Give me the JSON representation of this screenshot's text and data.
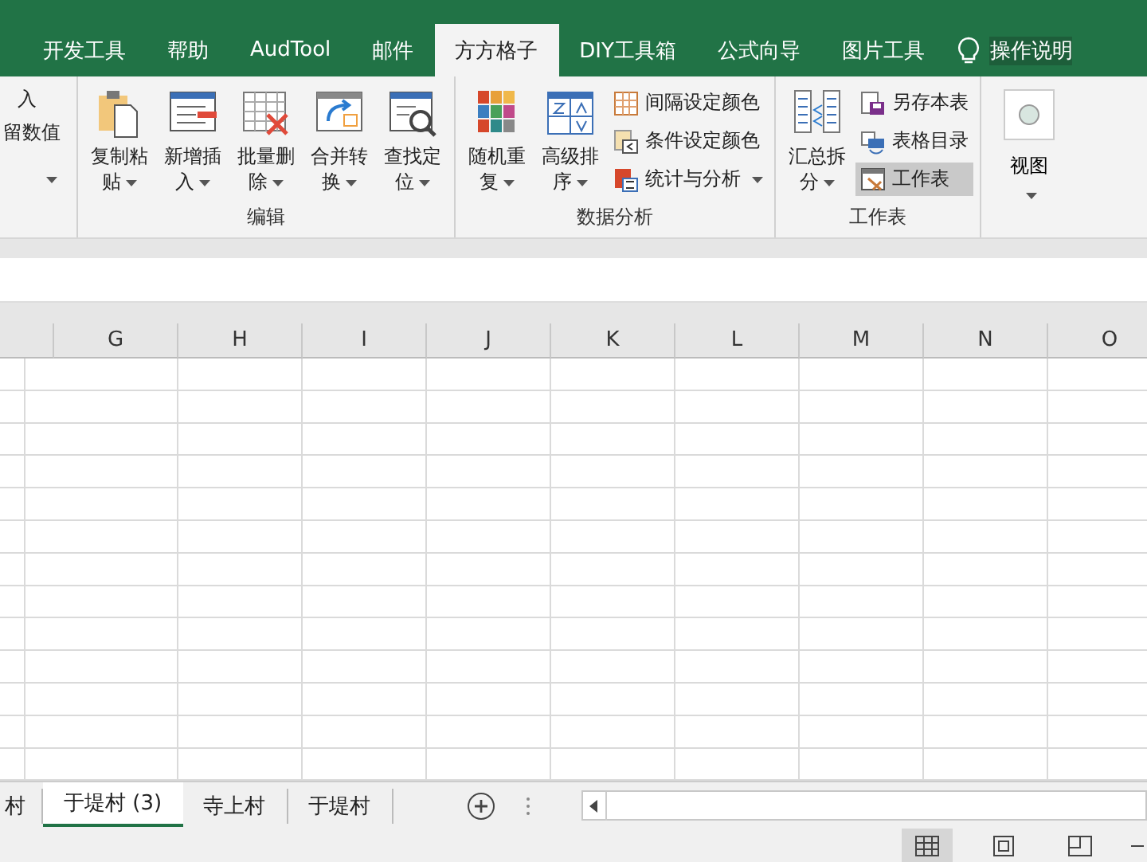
{
  "menu_tabs": [
    {
      "label": "开发工具",
      "selected": false
    },
    {
      "label": "帮助",
      "selected": false
    },
    {
      "label": "AudTool",
      "selected": false
    },
    {
      "label": "邮件",
      "selected": false
    },
    {
      "label": "方方格子",
      "selected": true
    },
    {
      "label": "DIY工具箱",
      "selected": false
    },
    {
      "label": "公式向导",
      "selected": false
    },
    {
      "label": "图片工具",
      "selected": false
    }
  ],
  "tell_me": "操作说明",
  "ribbon_groups": [
    {
      "dropdown": true,
      "items": [
        {
          "kind": "text",
          "label": "入"
        },
        {
          "kind": "text",
          "label": "留数值"
        }
      ]
    },
    {
      "label": "编辑",
      "items": [
        {
          "kind": "large",
          "label": "复制粘贴",
          "dropdown": true
        },
        {
          "kind": "large",
          "label": "新增插入",
          "dropdown": true
        },
        {
          "kind": "large",
          "label": "批量删除",
          "dropdown": true
        },
        {
          "kind": "large",
          "label": "合并转换",
          "dropdown": true
        },
        {
          "kind": "large",
          "label": "查找定位",
          "dropdown": true
        }
      ]
    },
    {
      "label": "数据分析",
      "items": [
        {
          "kind": "large",
          "label": "随机重复",
          "dropdown": true
        },
        {
          "kind": "large",
          "label": "高级排序",
          "dropdown": true
        },
        {
          "kind": "small",
          "label": "间隔设定颜色",
          "dropdown": false,
          "selected": false
        },
        {
          "kind": "small",
          "label": "条件设定颜色",
          "dropdown": false,
          "selected": false
        },
        {
          "kind": "small",
          "label": "统计与分析",
          "dropdown": true,
          "selected": false
        }
      ]
    },
    {
      "label": "工作表",
      "items": [
        {
          "kind": "large",
          "label": "汇总拆分",
          "dropdown": true
        },
        {
          "kind": "small",
          "label": "另存本表",
          "dropdown": false,
          "selected": false
        },
        {
          "kind": "small",
          "label": "表格目录",
          "dropdown": false,
          "selected": false
        },
        {
          "kind": "small",
          "label": "工作表",
          "dropdown": false,
          "selected": true
        }
      ]
    },
    {
      "items": [
        {
          "kind": "view",
          "label": "视图",
          "dropdown": true
        }
      ]
    }
  ],
  "columns": [
    "G",
    "H",
    "I",
    "J",
    "K",
    "L",
    "M",
    "N",
    "O"
  ],
  "sheet_tabs": [
    {
      "label": "村",
      "selected": false
    },
    {
      "label": "于堤村 (3)",
      "selected": true
    },
    {
      "label": "寺上村",
      "selected": false
    },
    {
      "label": "于堤村",
      "selected": false
    }
  ]
}
